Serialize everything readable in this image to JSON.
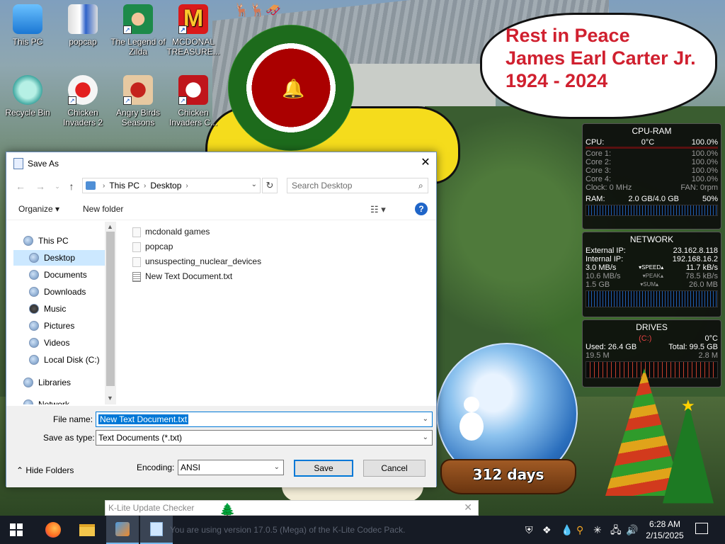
{
  "desktop_icons": [
    {
      "label": "This PC"
    },
    {
      "label": "popcap"
    },
    {
      "label": "The Legend of Zilda"
    },
    {
      "label": "MCDONAL TREASURE..."
    },
    {
      "label": "Recycle Bin"
    },
    {
      "label": "Chicken Invaders 2"
    },
    {
      "label": "Angry Birds Seasons"
    },
    {
      "label": "Chicken Invaders C..."
    }
  ],
  "speech_bubble": {
    "line1": "Rest in Peace",
    "line2": "James Earl Carter Jr.",
    "line3": "1924 - 2024"
  },
  "gadget_cpu": {
    "title": "CPU-RAM",
    "cpu_label": "CPU:",
    "cpu_temp": "0°C",
    "cpu_pct": "100.0%",
    "cores": [
      {
        "label": "Core 1:",
        "value": "100.0%"
      },
      {
        "label": "Core 2:",
        "value": "100.0%"
      },
      {
        "label": "Core 3:",
        "value": "100.0%"
      },
      {
        "label": "Core 4:",
        "value": "100.0%"
      }
    ],
    "clock": "Clock: 0 MHz",
    "fan": "FAN: 0rpm",
    "ram_label": "RAM:",
    "ram_value": "2.0 GB/4.0 GB",
    "ram_pct": "50%"
  },
  "gadget_net": {
    "title": "NETWORK",
    "ext_label": "External IP:",
    "ext_ip": "23.162.8.118",
    "int_label": "Internal IP:",
    "int_ip": "192.168.16.2",
    "speed_down": "3.0 MB/s",
    "speed_label": "▾SPEED▴",
    "speed_up": "11.7 kB/s",
    "peak_down": "10.6 MB/s",
    "peak_label": "▾PEAK▴",
    "peak_up": "78.5 kB/s",
    "sum_down": "1.5 GB",
    "sum_label": "▾SUM▴",
    "sum_up": "26.0 MB"
  },
  "gadget_drives": {
    "title": "DRIVES",
    "drive": "(C:)",
    "temp": "0°C",
    "used": "Used: 26.4 GB",
    "total": "Total: 99.5 GB",
    "read": "19.5 M",
    "write": "2.8 M"
  },
  "snow_globe": {
    "days": "312 days"
  },
  "dialog": {
    "title": "Save As",
    "address": {
      "root": "This PC",
      "folder": "Desktop"
    },
    "search_placeholder": "Search Desktop",
    "organize": "Organize ▾",
    "new_folder": "New folder",
    "nav": [
      {
        "label": "This PC"
      },
      {
        "label": "Desktop"
      },
      {
        "label": "Documents"
      },
      {
        "label": "Downloads"
      },
      {
        "label": "Music"
      },
      {
        "label": "Pictures"
      },
      {
        "label": "Videos"
      },
      {
        "label": "Local Disk (C:)"
      },
      {
        "label": "Libraries"
      },
      {
        "label": "Network"
      }
    ],
    "files": [
      {
        "name": "mcdonald games",
        "kind": "folder"
      },
      {
        "name": "popcap",
        "kind": "folder"
      },
      {
        "name": "unsuspecting_nuclear_devices",
        "kind": "folder"
      },
      {
        "name": "New Text Document.txt",
        "kind": "text"
      }
    ],
    "file_name_label": "File name:",
    "file_name_value": "New Text Document.txt",
    "save_type_label": "Save as type:",
    "save_type_value": "Text Documents (*.txt)",
    "encoding_label": "Encoding:",
    "encoding_value": "ANSI",
    "save": "Save",
    "cancel": "Cancel",
    "hide_folders": "Hide Folders"
  },
  "klite": {
    "title": "K-Lite Update Checker",
    "ghost_text": "You are using version 17.0.5 (Mega) of the K-Lite Codec Pack."
  },
  "taskbar": {
    "time": "6:28 AM",
    "date": "2/15/2025"
  },
  "colors": {
    "accent": "#0078d7",
    "selection_bg": "#cce8ff",
    "speech_text": "#d0202f",
    "taskbar": "#161b25"
  }
}
